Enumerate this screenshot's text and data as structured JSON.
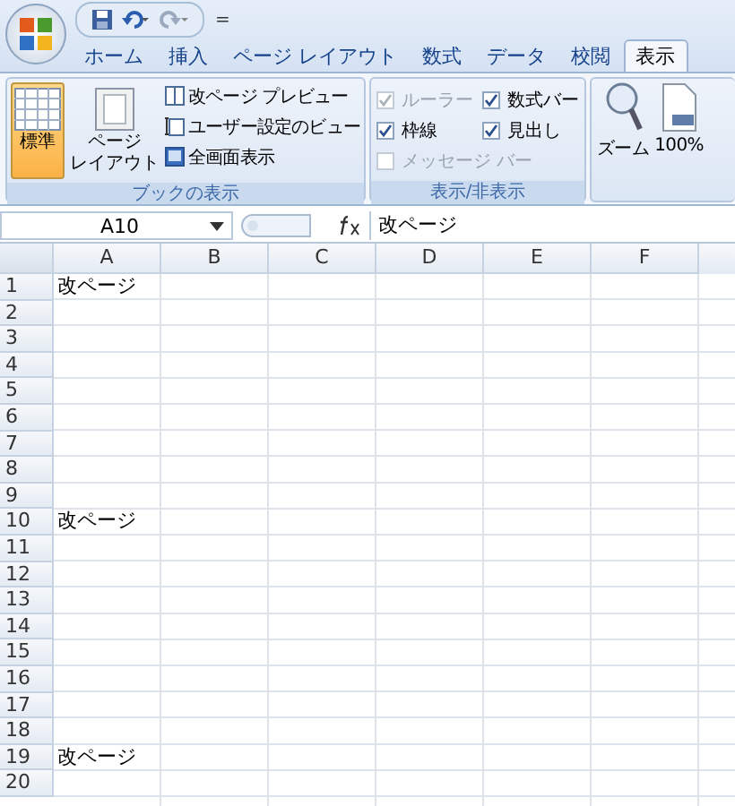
{
  "quick_access": {
    "customize": "="
  },
  "tabs": [
    {
      "label": "ホーム",
      "selected": false
    },
    {
      "label": "挿入",
      "selected": false
    },
    {
      "label": "ページ レイアウト",
      "selected": false
    },
    {
      "label": "数式",
      "selected": false
    },
    {
      "label": "データ",
      "selected": false
    },
    {
      "label": "校閲",
      "selected": false
    },
    {
      "label": "表示",
      "selected": true
    }
  ],
  "ribbon": {
    "groups": [
      {
        "kind": "views",
        "title": "ブックの表示",
        "large": [
          {
            "lines": [
              "標準"
            ],
            "selected": true
          },
          {
            "lines": [
              "ページ",
              "レイアウト"
            ],
            "selected": false
          }
        ],
        "small": [
          "改ページ プレビュー",
          "ユーザー設定のビュー",
          "全画面表示"
        ]
      },
      {
        "kind": "checks",
        "title": "表示/非表示",
        "checks": [
          {
            "label": "ルーラー",
            "checked": true,
            "disabled": true
          },
          {
            "label": "数式バー",
            "checked": true,
            "disabled": false
          },
          {
            "label": "枠線",
            "checked": true,
            "disabled": false
          },
          {
            "label": "見出し",
            "checked": true,
            "disabled": false
          },
          {
            "label": "メッセージ バー",
            "checked": false,
            "disabled": true
          }
        ]
      },
      {
        "kind": "zoom",
        "buttons": [
          "ズーム",
          "100%"
        ]
      }
    ]
  },
  "formula_bar": {
    "name_box": "A10",
    "value": "改ページ"
  },
  "sheet": {
    "columns": [
      "A",
      "B",
      "C",
      "D",
      "E",
      "F"
    ],
    "rows": [
      {
        "number": "1",
        "a": "改ページ"
      },
      {
        "number": "2"
      },
      {
        "number": "3"
      },
      {
        "number": "4"
      },
      {
        "number": "5"
      },
      {
        "number": "6"
      },
      {
        "number": "7"
      },
      {
        "number": "8"
      },
      {
        "number": "9"
      },
      {
        "number": "10",
        "a": "改ページ"
      },
      {
        "number": "11"
      },
      {
        "number": "12"
      },
      {
        "number": "13"
      },
      {
        "number": "14"
      },
      {
        "number": "15"
      },
      {
        "number": "16"
      },
      {
        "number": "17"
      },
      {
        "number": "18"
      },
      {
        "number": "19",
        "a": "改ページ"
      },
      {
        "number": "20"
      }
    ]
  }
}
